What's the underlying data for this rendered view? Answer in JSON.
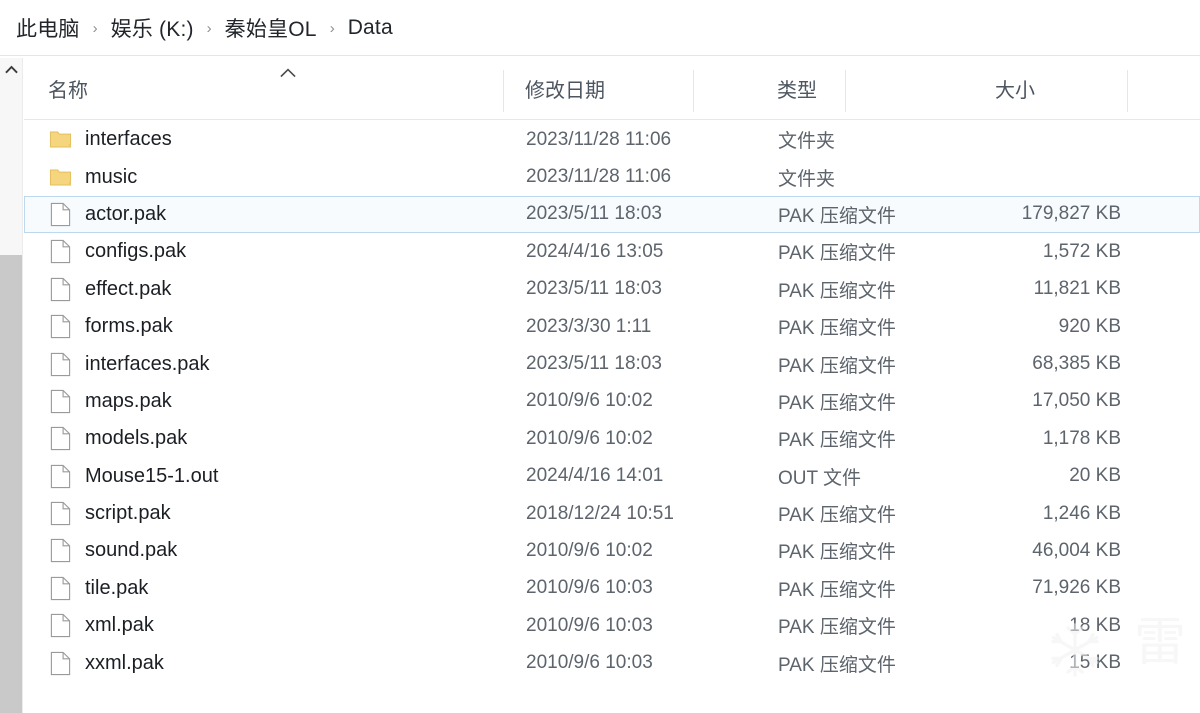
{
  "window": {
    "app": "File Explorer"
  },
  "breadcrumb": {
    "separator": "›",
    "items": [
      {
        "label": "此电脑"
      },
      {
        "label": "娱乐 (K:)"
      },
      {
        "label": "秦始皇OL"
      },
      {
        "label": "Data"
      }
    ]
  },
  "columns": {
    "name": "名称",
    "date_modified": "修改日期",
    "type": "类型",
    "size": "大小",
    "sort_icon": "chevron-up-icon",
    "sort_column": "名称",
    "sort_direction": "ascending"
  },
  "scrollbar": {
    "up_icon": "chevron-up-icon",
    "orientation": "vertical"
  },
  "colors": {
    "selection_border": "#bcd9ef",
    "selection_fill": "#f7fbfe",
    "folder_icon": "#f6d57f",
    "header_text": "#4c5560",
    "row_text": "#1b1f24",
    "meta_text": "#5d646c"
  },
  "files": [
    {
      "name": "interfaces",
      "icon": "folder-icon",
      "date": "2023/11/28 11:06",
      "type": "文件夹",
      "size": "",
      "selected": false
    },
    {
      "name": "music",
      "icon": "folder-icon",
      "date": "2023/11/28 11:06",
      "type": "文件夹",
      "size": "",
      "selected": false
    },
    {
      "name": "actor.pak",
      "icon": "file-icon",
      "date": "2023/5/11 18:03",
      "type": "PAK 压缩文件",
      "size": "179,827 KB",
      "selected": true
    },
    {
      "name": "configs.pak",
      "icon": "file-icon",
      "date": "2024/4/16 13:05",
      "type": "PAK 压缩文件",
      "size": "1,572 KB",
      "selected": false
    },
    {
      "name": "effect.pak",
      "icon": "file-icon",
      "date": "2023/5/11 18:03",
      "type": "PAK 压缩文件",
      "size": "11,821 KB",
      "selected": false
    },
    {
      "name": "forms.pak",
      "icon": "file-icon",
      "date": "2023/3/30 1:11",
      "type": "PAK 压缩文件",
      "size": "920 KB",
      "selected": false
    },
    {
      "name": "interfaces.pak",
      "icon": "file-icon",
      "date": "2023/5/11 18:03",
      "type": "PAK 压缩文件",
      "size": "68,385 KB",
      "selected": false
    },
    {
      "name": "maps.pak",
      "icon": "file-icon",
      "date": "2010/9/6 10:02",
      "type": "PAK 压缩文件",
      "size": "17,050 KB",
      "selected": false
    },
    {
      "name": "models.pak",
      "icon": "file-icon",
      "date": "2010/9/6 10:02",
      "type": "PAK 压缩文件",
      "size": "1,178 KB",
      "selected": false
    },
    {
      "name": "Mouse15-1.out",
      "icon": "file-icon",
      "date": "2024/4/16 14:01",
      "type": "OUT 文件",
      "size": "20 KB",
      "selected": false
    },
    {
      "name": "script.pak",
      "icon": "file-icon",
      "date": "2018/12/24 10:51",
      "type": "PAK 压缩文件",
      "size": "1,246 KB",
      "selected": false
    },
    {
      "name": "sound.pak",
      "icon": "file-icon",
      "date": "2010/9/6 10:02",
      "type": "PAK 压缩文件",
      "size": "46,004 KB",
      "selected": false
    },
    {
      "name": "tile.pak",
      "icon": "file-icon",
      "date": "2010/9/6 10:03",
      "type": "PAK 压缩文件",
      "size": "71,926 KB",
      "selected": false
    },
    {
      "name": "xml.pak",
      "icon": "file-icon",
      "date": "2010/9/6 10:03",
      "type": "PAK 压缩文件",
      "size": "18 KB",
      "selected": false
    },
    {
      "name": "xxml.pak",
      "icon": "file-icon",
      "date": "2010/9/6 10:03",
      "type": "PAK 压缩文件",
      "size": "15 KB",
      "selected": false
    }
  ],
  "watermark": {
    "text": "雷",
    "icon": "snowflake-icon"
  }
}
